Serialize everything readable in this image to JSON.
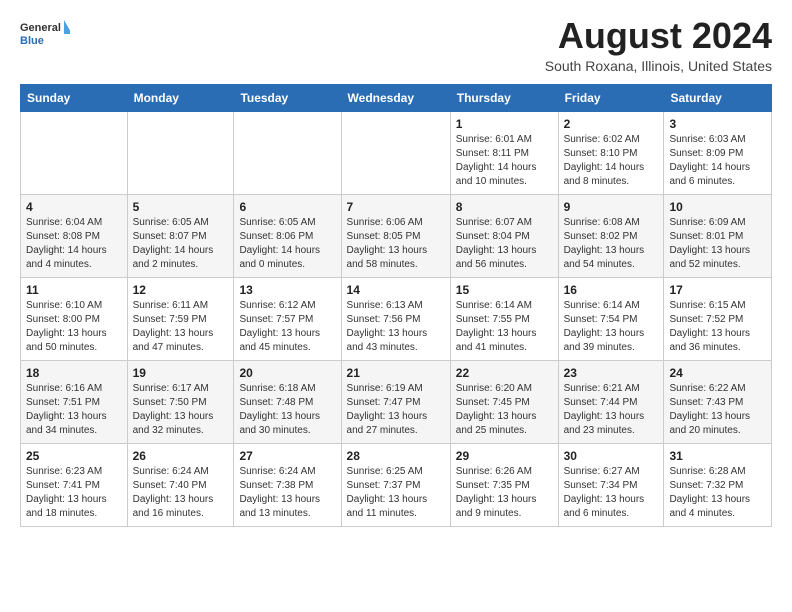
{
  "header": {
    "logo_line1": "General",
    "logo_line2": "Blue",
    "month_year": "August 2024",
    "location": "South Roxana, Illinois, United States"
  },
  "weekdays": [
    "Sunday",
    "Monday",
    "Tuesday",
    "Wednesday",
    "Thursday",
    "Friday",
    "Saturday"
  ],
  "weeks": [
    [
      {
        "day": "",
        "info": ""
      },
      {
        "day": "",
        "info": ""
      },
      {
        "day": "",
        "info": ""
      },
      {
        "day": "",
        "info": ""
      },
      {
        "day": "1",
        "info": "Sunrise: 6:01 AM\nSunset: 8:11 PM\nDaylight: 14 hours\nand 10 minutes."
      },
      {
        "day": "2",
        "info": "Sunrise: 6:02 AM\nSunset: 8:10 PM\nDaylight: 14 hours\nand 8 minutes."
      },
      {
        "day": "3",
        "info": "Sunrise: 6:03 AM\nSunset: 8:09 PM\nDaylight: 14 hours\nand 6 minutes."
      }
    ],
    [
      {
        "day": "4",
        "info": "Sunrise: 6:04 AM\nSunset: 8:08 PM\nDaylight: 14 hours\nand 4 minutes."
      },
      {
        "day": "5",
        "info": "Sunrise: 6:05 AM\nSunset: 8:07 PM\nDaylight: 14 hours\nand 2 minutes."
      },
      {
        "day": "6",
        "info": "Sunrise: 6:05 AM\nSunset: 8:06 PM\nDaylight: 14 hours\nand 0 minutes."
      },
      {
        "day": "7",
        "info": "Sunrise: 6:06 AM\nSunset: 8:05 PM\nDaylight: 13 hours\nand 58 minutes."
      },
      {
        "day": "8",
        "info": "Sunrise: 6:07 AM\nSunset: 8:04 PM\nDaylight: 13 hours\nand 56 minutes."
      },
      {
        "day": "9",
        "info": "Sunrise: 6:08 AM\nSunset: 8:02 PM\nDaylight: 13 hours\nand 54 minutes."
      },
      {
        "day": "10",
        "info": "Sunrise: 6:09 AM\nSunset: 8:01 PM\nDaylight: 13 hours\nand 52 minutes."
      }
    ],
    [
      {
        "day": "11",
        "info": "Sunrise: 6:10 AM\nSunset: 8:00 PM\nDaylight: 13 hours\nand 50 minutes."
      },
      {
        "day": "12",
        "info": "Sunrise: 6:11 AM\nSunset: 7:59 PM\nDaylight: 13 hours\nand 47 minutes."
      },
      {
        "day": "13",
        "info": "Sunrise: 6:12 AM\nSunset: 7:57 PM\nDaylight: 13 hours\nand 45 minutes."
      },
      {
        "day": "14",
        "info": "Sunrise: 6:13 AM\nSunset: 7:56 PM\nDaylight: 13 hours\nand 43 minutes."
      },
      {
        "day": "15",
        "info": "Sunrise: 6:14 AM\nSunset: 7:55 PM\nDaylight: 13 hours\nand 41 minutes."
      },
      {
        "day": "16",
        "info": "Sunrise: 6:14 AM\nSunset: 7:54 PM\nDaylight: 13 hours\nand 39 minutes."
      },
      {
        "day": "17",
        "info": "Sunrise: 6:15 AM\nSunset: 7:52 PM\nDaylight: 13 hours\nand 36 minutes."
      }
    ],
    [
      {
        "day": "18",
        "info": "Sunrise: 6:16 AM\nSunset: 7:51 PM\nDaylight: 13 hours\nand 34 minutes."
      },
      {
        "day": "19",
        "info": "Sunrise: 6:17 AM\nSunset: 7:50 PM\nDaylight: 13 hours\nand 32 minutes."
      },
      {
        "day": "20",
        "info": "Sunrise: 6:18 AM\nSunset: 7:48 PM\nDaylight: 13 hours\nand 30 minutes."
      },
      {
        "day": "21",
        "info": "Sunrise: 6:19 AM\nSunset: 7:47 PM\nDaylight: 13 hours\nand 27 minutes."
      },
      {
        "day": "22",
        "info": "Sunrise: 6:20 AM\nSunset: 7:45 PM\nDaylight: 13 hours\nand 25 minutes."
      },
      {
        "day": "23",
        "info": "Sunrise: 6:21 AM\nSunset: 7:44 PM\nDaylight: 13 hours\nand 23 minutes."
      },
      {
        "day": "24",
        "info": "Sunrise: 6:22 AM\nSunset: 7:43 PM\nDaylight: 13 hours\nand 20 minutes."
      }
    ],
    [
      {
        "day": "25",
        "info": "Sunrise: 6:23 AM\nSunset: 7:41 PM\nDaylight: 13 hours\nand 18 minutes."
      },
      {
        "day": "26",
        "info": "Sunrise: 6:24 AM\nSunset: 7:40 PM\nDaylight: 13 hours\nand 16 minutes."
      },
      {
        "day": "27",
        "info": "Sunrise: 6:24 AM\nSunset: 7:38 PM\nDaylight: 13 hours\nand 13 minutes."
      },
      {
        "day": "28",
        "info": "Sunrise: 6:25 AM\nSunset: 7:37 PM\nDaylight: 13 hours\nand 11 minutes."
      },
      {
        "day": "29",
        "info": "Sunrise: 6:26 AM\nSunset: 7:35 PM\nDaylight: 13 hours\nand 9 minutes."
      },
      {
        "day": "30",
        "info": "Sunrise: 6:27 AM\nSunset: 7:34 PM\nDaylight: 13 hours\nand 6 minutes."
      },
      {
        "day": "31",
        "info": "Sunrise: 6:28 AM\nSunset: 7:32 PM\nDaylight: 13 hours\nand 4 minutes."
      }
    ]
  ]
}
